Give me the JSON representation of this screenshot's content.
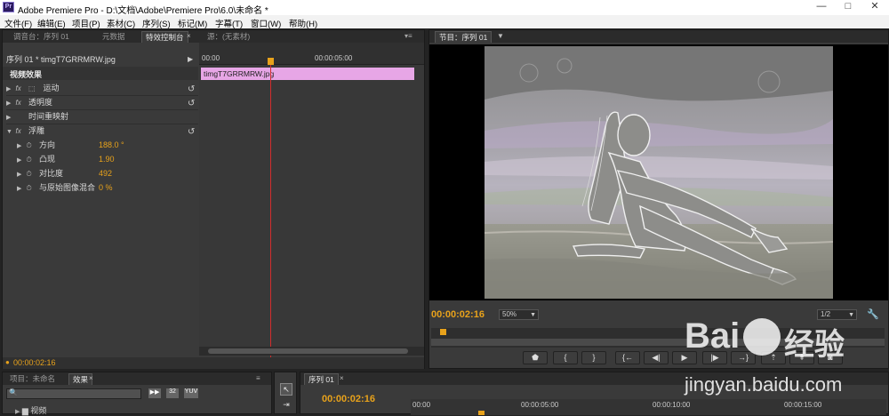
{
  "window": {
    "app_title": "Adobe Premiere Pro - D:\\文档\\Adobe\\Premiere Pro\\6.0\\未命名 *",
    "minimize": "—",
    "maximize": "□",
    "close": "✕"
  },
  "menu": [
    "文件(F)",
    "编辑(E)",
    "项目(P)",
    "素材(C)",
    "序列(S)",
    "标记(M)",
    "字幕(T)",
    "窗口(W)",
    "帮助(H)"
  ],
  "left_tabs": {
    "mixer": "调音台：序列 01",
    "metadata": "元数据",
    "effect_controls": "特效控制台",
    "source": "源：(无素材)"
  },
  "effect_controls": {
    "clip_title": "序列 01 * timgT7GRRMRW.jpg",
    "section": "视频效果",
    "timecode_start": "00:00",
    "timecode_5s": "00:00:05:00",
    "clip_bar_label": "timgT7GRRMRW.jpg",
    "current_time": "00:00:02:16",
    "effects": [
      {
        "name": "运动"
      },
      {
        "name": "透明度"
      },
      {
        "name": "时间重映射"
      },
      {
        "name": "浮雕"
      }
    ],
    "params": [
      {
        "label": "方向",
        "value": "188.0 °"
      },
      {
        "label": "凸现",
        "value": "1.90"
      },
      {
        "label": "对比度",
        "value": "492"
      },
      {
        "label": "与原始图像混合",
        "value": "0 %"
      }
    ]
  },
  "program": {
    "tab": "节目：序列 01",
    "timecode": "00:00:02:16",
    "zoom": "50%",
    "resolution": "1/2",
    "playhead_fraction": 0.02
  },
  "bottom": {
    "project_tab": "项目：未命名",
    "effects_tab": "效果",
    "folder": "视频",
    "sequence_tab": "序列 01",
    "timecode": "00:00:02:16",
    "ruler": [
      "00:00",
      "00:00:05:00",
      "00:00:10:00",
      "00:00:15:00"
    ]
  },
  "watermark": {
    "brand": "Bai",
    "brand2": "经验",
    "url": "jingyan.baidu.com"
  },
  "colors": {
    "accent_timecode": "#e8a21b",
    "clip_bar": "#e7a6e6",
    "playhead": "#d32d2d"
  }
}
